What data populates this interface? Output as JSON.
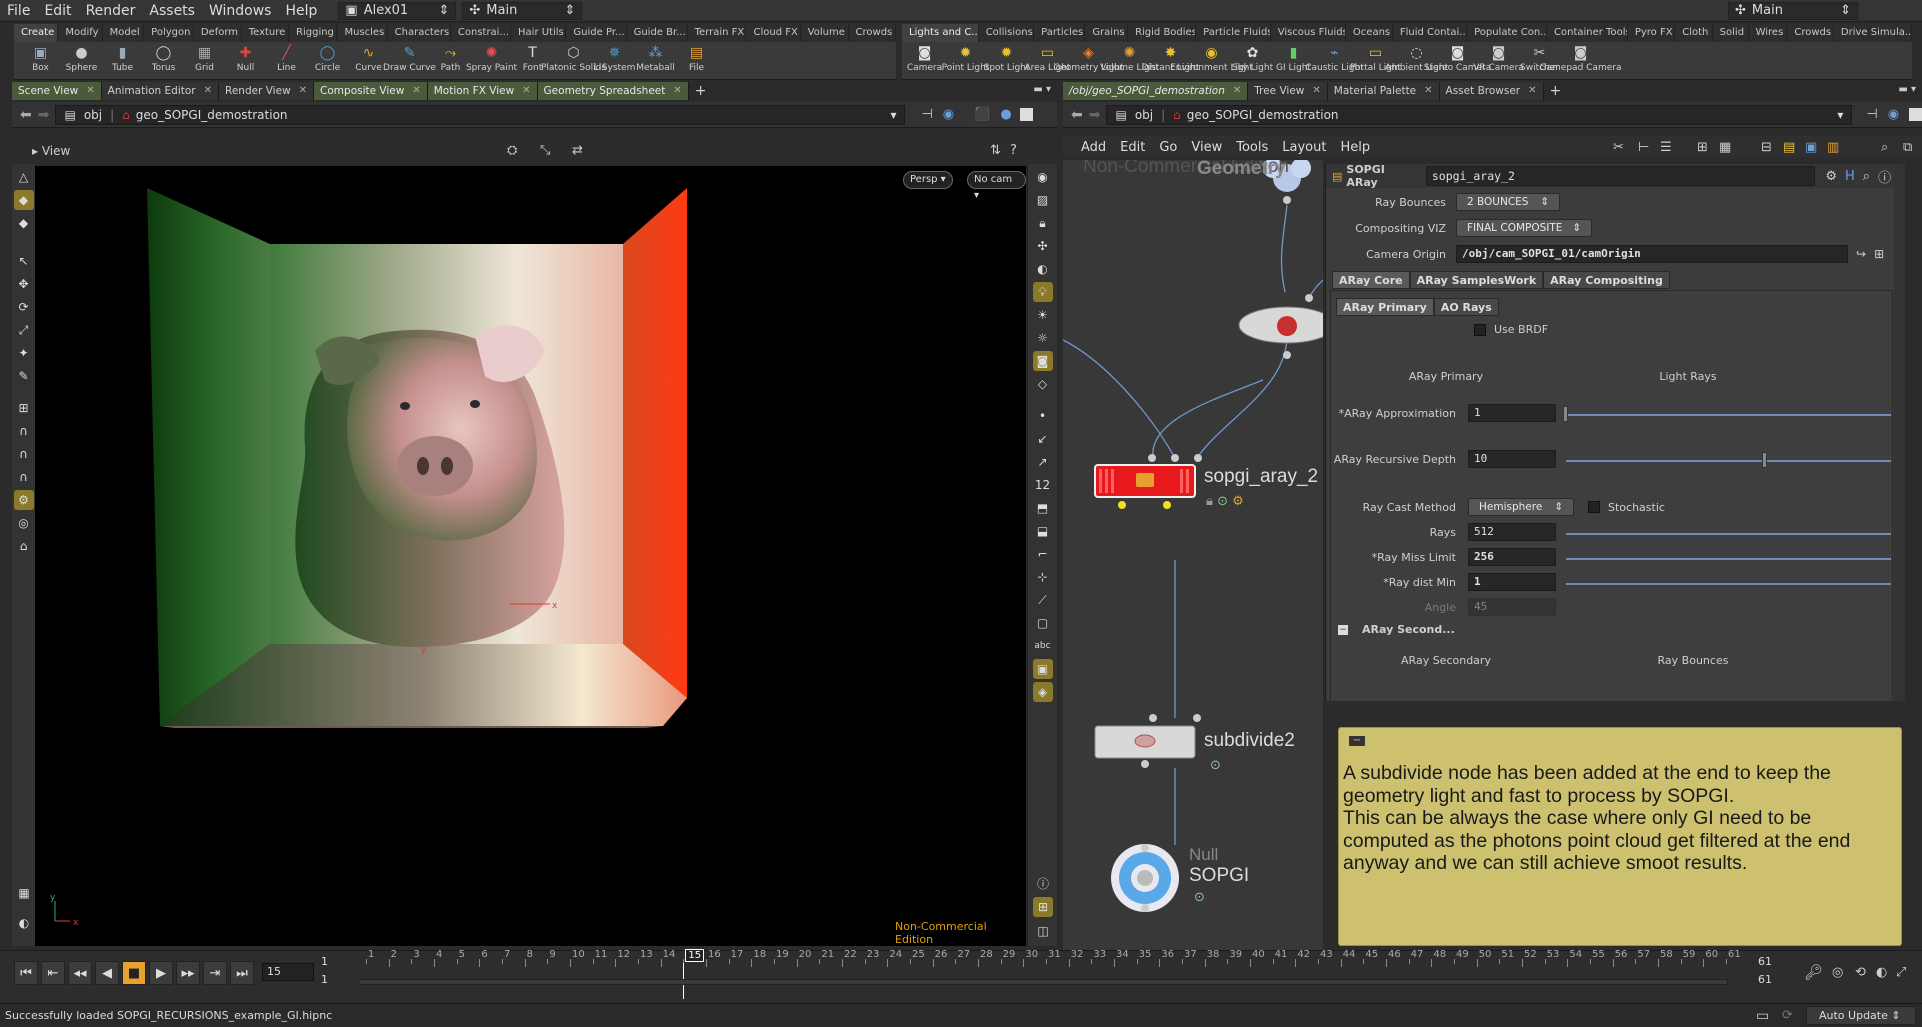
{
  "menubar": {
    "items": [
      "File",
      "Edit",
      "Render",
      "Assets",
      "Windows",
      "Help"
    ],
    "desktop": "Alex01",
    "context": "Main",
    "right_context": "Main"
  },
  "shelf_left": {
    "tabs": [
      "Create",
      "Modify",
      "Model",
      "Polygon",
      "Deform",
      "Texture",
      "Rigging",
      "Muscles",
      "Characters",
      "Constrai...",
      "Hair Utils",
      "Guide Pr...",
      "Guide Br...",
      "Terrain FX",
      "Cloud FX",
      "Volume",
      "Crowds"
    ],
    "tools": [
      "Box",
      "Sphere",
      "Tube",
      "Torus",
      "Grid",
      "Null",
      "Line",
      "Circle",
      "Curve",
      "Draw Curve",
      "Path",
      "Spray Paint",
      "Font",
      "Platonic Solids",
      "L-System",
      "Metaball",
      "File"
    ]
  },
  "shelf_right": {
    "tabs": [
      "Lights and C...",
      "Collisions",
      "Particles",
      "Grains",
      "Rigid Bodies",
      "Particle Fluids",
      "Viscous Fluids",
      "Oceans",
      "Fluid Contai...",
      "Populate Con...",
      "Container Tools",
      "Pyro FX",
      "Cloth",
      "Solid",
      "Wires",
      "Crowds",
      "Drive Simula..."
    ],
    "tools": [
      "Camera",
      "Point Light",
      "Spot Light",
      "Area Light",
      "Geometry Light",
      "Volume Light",
      "Distant Light",
      "Environment Light",
      "Sky Light",
      "GI Light",
      "Caustic Light",
      "Portal Light",
      "Ambient Light",
      "Stereo Camera",
      "VR Camera",
      "Switcher",
      "Gamepad Camera"
    ]
  },
  "left_pane": {
    "tabs": [
      "Scene View",
      "Animation Editor",
      "Render View",
      "Composite View",
      "Motion FX View",
      "Geometry Spreadsheet"
    ],
    "path_root": "obj",
    "path_node": "geo_SOPGI_demostration",
    "view_label": "View",
    "persp": "Persp",
    "cam": "No cam",
    "watermark": "Non-Commercial Edition"
  },
  "right_pane": {
    "tabs": [
      "/obj/geo_SOPGI_demostration",
      "Tree View",
      "Material Palette",
      "Asset Browser"
    ],
    "path_root": "obj",
    "path_node": "geo_SOPGI_demostration",
    "menu": [
      "Add",
      "Edit",
      "Go",
      "View",
      "Tools",
      "Layout",
      "Help"
    ],
    "net_watermark": "Non-Commercial Edition",
    "net_geo_text": "Geometry"
  },
  "nodes": {
    "aray": "sopgi_aray_2",
    "subdivide": "subdivide2",
    "null_type": "Null",
    "null_name": "SOPGI"
  },
  "parms": {
    "node_type": "SOPGI ARay",
    "node_name": "sopgi_aray_2",
    "ray_bounces_label": "Ray Bounces",
    "ray_bounces": "2 BOUNCES",
    "comp_viz_label": "Compositing VIZ",
    "comp_viz": "FINAL COMPOSITE",
    "cam_origin_label": "Camera Origin",
    "cam_origin": "/obj/cam_SOPGI_01/camOrigin",
    "tabs": [
      "ARay Core",
      "ARay SamplesWork",
      "ARay Compositing"
    ],
    "subtabs": [
      "ARay Primary",
      "AO Rays"
    ],
    "use_brdf": "Use BRDF",
    "col_a": "ARay Primary",
    "col_b": "Light Rays",
    "approx_label": "*ARay Approximation",
    "approx": "1",
    "depth_label": "ARay Recursive Depth",
    "depth": "10",
    "cast_label": "Ray Cast Method",
    "cast": "Hemisphere",
    "stochastic": "Stochastic",
    "rays_label": "Rays",
    "rays": "512",
    "miss_label": "*Ray Miss Limit",
    "miss": "256",
    "distmin_label": "*Ray dist Min",
    "distmin": "1",
    "angle_label": "Angle",
    "angle": "45",
    "secondary_header": "ARay Second...",
    "col_c": "ARay Secondary",
    "col_d": "Ray Bounces"
  },
  "note": {
    "text": "A subdivide node has been added at the end to keep the geometry light and fast to process by SOPGI.\nThis can be always the case where only GI need to be computed as the photons point cloud get filtered at the end anyway and we can still achieve smoot results."
  },
  "timeline": {
    "current_frame": "15",
    "start": "1",
    "start2": "1",
    "end": "61",
    "end2": "61",
    "ticks": [
      1,
      2,
      3,
      4,
      5,
      6,
      7,
      8,
      9,
      10,
      11,
      12,
      13,
      14,
      15,
      16,
      17,
      18,
      19,
      20,
      21,
      22,
      23,
      24,
      25,
      26,
      27,
      28,
      29,
      30,
      31,
      32,
      33,
      34,
      35,
      36,
      37,
      38,
      39,
      40,
      41,
      42,
      43,
      44,
      45,
      46,
      47,
      48,
      49,
      50,
      51,
      52,
      53,
      54,
      55,
      56,
      57,
      58,
      59,
      60,
      61
    ]
  },
  "status": {
    "message": "Successfully loaded SOPGI_RECURSIONS_example_GI.hipnc",
    "update": "Auto Update"
  },
  "colors": {
    "node_aray": "#e8191c",
    "note_bg": "#cdc06f",
    "wire": "#6f98c8"
  }
}
